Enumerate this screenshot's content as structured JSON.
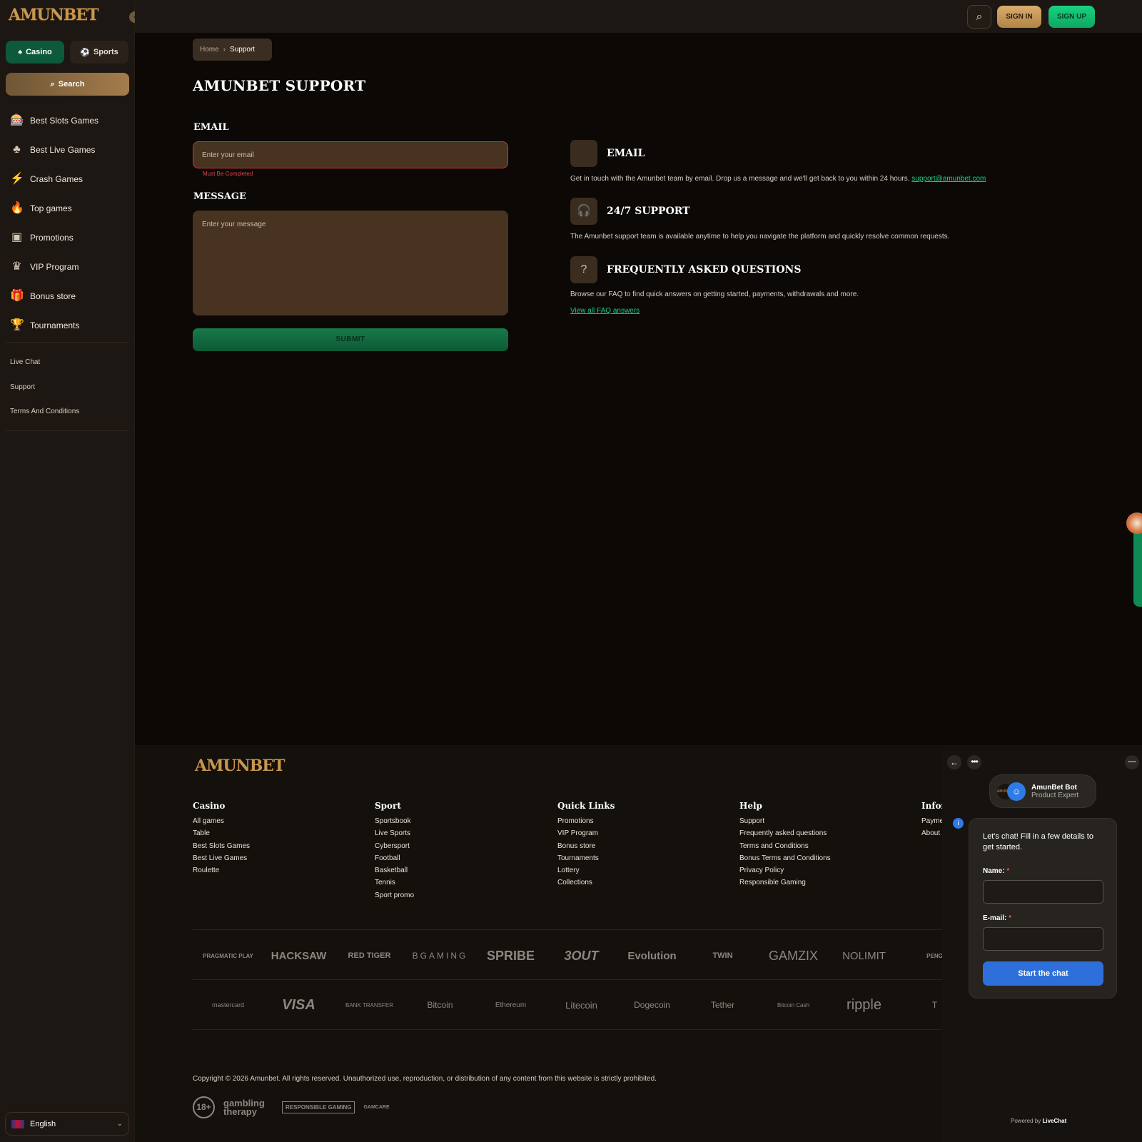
{
  "brand": {
    "logo_text": "AMUNBET",
    "accent": "#17d180",
    "gold": "#c9974f",
    "bg": "#0b0806"
  },
  "sidebar": {
    "tabs": [
      {
        "label": "Casino",
        "icon": "spade-icon"
      },
      {
        "label": "Sports",
        "icon": "ball-icon"
      }
    ],
    "search_label": "Search",
    "items": [
      {
        "label": "Best Slots Games",
        "icon": "slot-machine-icon"
      },
      {
        "label": "Best Live Games",
        "icon": "dealer-icon"
      },
      {
        "label": "Crash Games",
        "icon": "lightning-icon"
      },
      {
        "label": "Top games",
        "icon": "flame-icon"
      },
      {
        "label": "Promotions",
        "icon": "promo-icon"
      },
      {
        "label": "VIP Program",
        "icon": "crown-icon"
      },
      {
        "label": "Bonus store",
        "icon": "gift-icon"
      },
      {
        "label": "Tournaments",
        "icon": "trophy-icon"
      }
    ],
    "links": [
      "Live Chat",
      "Support",
      "Terms And Conditions"
    ],
    "language": "English"
  },
  "header": {
    "sign_in": "SIGN IN",
    "sign_up": "SIGN UP"
  },
  "breadcrumb": {
    "home": "Home",
    "current": "Support"
  },
  "page": {
    "title": "AMUNBET SUPPORT",
    "email_label": "EMAIL",
    "email_placeholder": "Enter your email",
    "email_error": "Must Be Completed",
    "message_label": "MESSAGE",
    "message_placeholder": "Enter your message",
    "submit": "SUBMIT"
  },
  "info": {
    "email_title": "EMAIL",
    "email_text": "Get in touch with the Amunbet team by email. Drop us a message and we'll get back to you within 24 hours.",
    "email_link": "support@amunbet.com",
    "support_title": "24/7 SUPPORT",
    "support_text": "The Amunbet support team is available anytime to help you navigate the platform and quickly resolve common requests.",
    "faq_title": "FREQUENTLY ASKED QUESTIONS",
    "faq_text": "Browse our FAQ to find quick answers on getting started, payments, withdrawals and more.",
    "faq_link": "View all FAQ answers"
  },
  "footer": {
    "columns": [
      {
        "title": "Casino",
        "items": [
          "All games",
          "Table",
          "Best Slots Games",
          "Best Live Games",
          "Roulette"
        ]
      },
      {
        "title": "Sport",
        "items": [
          "Sportsbook",
          "Live Sports",
          "Cybersport",
          "Football",
          "Basketball",
          "Tennis",
          "Sport promo"
        ]
      },
      {
        "title": "Quick Links",
        "items": [
          "Promotions",
          "VIP Program",
          "Bonus store",
          "Tournaments",
          "Lottery",
          "Collections"
        ]
      },
      {
        "title": "Help",
        "items": [
          "Support",
          "Frequently asked questions",
          "Terms and Conditions",
          "Bonus Terms and Conditions",
          "Privacy Policy",
          "Responsible Gaming"
        ]
      },
      {
        "title": "Infor",
        "items": [
          "Payme",
          "About"
        ]
      }
    ],
    "providers": [
      "PRAGMATIC PLAY",
      "HACKSAW",
      "RED TIGER",
      "BGAMING",
      "SPRIBE",
      "3OUT",
      "Evolution",
      "TWIN",
      "GAMZIX",
      "NOLIMIT",
      "PENG"
    ],
    "payments": [
      "mastercard",
      "VISA",
      "BANK TRANSFER",
      "Bitcoin",
      "Ethereum",
      "Litecoin",
      "Dogecoin",
      "Tether",
      "Bitcoin Cash",
      "ripple",
      "T"
    ],
    "copyright": "Copyright © 2026 Amunbet. All rights reserved. Unauthorized use, reproduction, or distribution of any content from this website is strictly prohibited.",
    "badges": [
      "18+",
      "gambling therapy",
      "RESPONSIBLE GAMING",
      "GAMCARE"
    ]
  },
  "chat": {
    "bot_name": "AmunBet Bot",
    "bot_role": "Product Expert",
    "intro": "Let's chat! Fill in a few details to get started.",
    "name_label": "Name:",
    "email_label": "E-mail:",
    "required_mark": "*",
    "start": "Start the chat",
    "powered": "Powered by",
    "powered_brand": "LiveChat"
  }
}
